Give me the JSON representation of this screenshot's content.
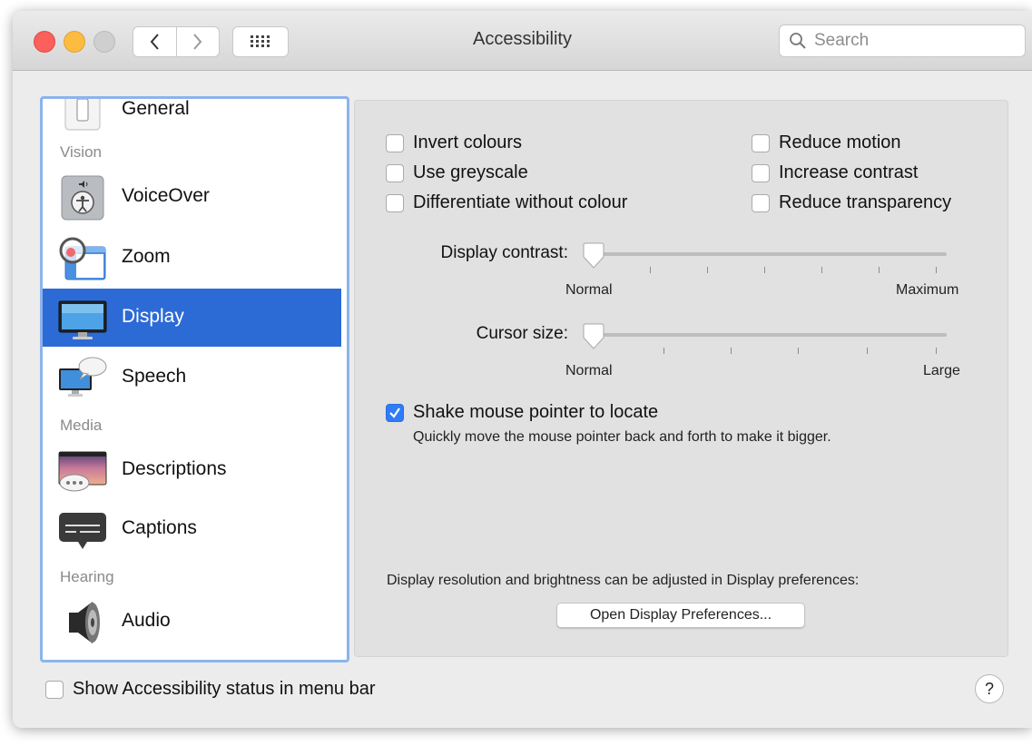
{
  "window": {
    "title": "Accessibility",
    "search_placeholder": "Search"
  },
  "sidebar": {
    "items": [
      {
        "label": "General",
        "icon": "general-icon",
        "selected": false
      },
      {
        "section": "Vision"
      },
      {
        "label": "VoiceOver",
        "icon": "voiceover-icon",
        "selected": false
      },
      {
        "label": "Zoom",
        "icon": "zoom-icon",
        "selected": false
      },
      {
        "label": "Display",
        "icon": "display-icon",
        "selected": true
      },
      {
        "label": "Speech",
        "icon": "speech-icon",
        "selected": false
      },
      {
        "section": "Media"
      },
      {
        "label": "Descriptions",
        "icon": "descriptions-icon",
        "selected": false
      },
      {
        "label": "Captions",
        "icon": "captions-icon",
        "selected": false
      },
      {
        "section": "Hearing"
      },
      {
        "label": "Audio",
        "icon": "audio-icon",
        "selected": false
      }
    ]
  },
  "display": {
    "checkboxes_left": [
      {
        "label": "Invert colours",
        "checked": false
      },
      {
        "label": "Use greyscale",
        "checked": false
      },
      {
        "label": "Differentiate without colour",
        "checked": false
      }
    ],
    "checkboxes_right": [
      {
        "label": "Reduce motion",
        "checked": false
      },
      {
        "label": "Increase contrast",
        "checked": false
      },
      {
        "label": "Reduce transparency",
        "checked": false
      }
    ],
    "contrast": {
      "label": "Display contrast:",
      "min_label": "Normal",
      "max_label": "Maximum",
      "value": 0
    },
    "cursor": {
      "label": "Cursor size:",
      "min_label": "Normal",
      "max_label": "Large",
      "value": 0
    },
    "shake": {
      "label": "Shake mouse pointer to locate",
      "checked": true,
      "description": "Quickly move the mouse pointer back and forth to make it bigger."
    },
    "resolution_note": "Display resolution and brightness can be adjusted in Display preferences:",
    "open_prefs_button": "Open Display Preferences..."
  },
  "footer": {
    "status_checkbox": {
      "label": "Show Accessibility status in menu bar",
      "checked": false
    },
    "help": "?"
  },
  "colors": {
    "selection": "#2c6ad6",
    "checkbox_on": "#2f7cf6",
    "sidebar_focus_ring": "#8cb4ec"
  }
}
